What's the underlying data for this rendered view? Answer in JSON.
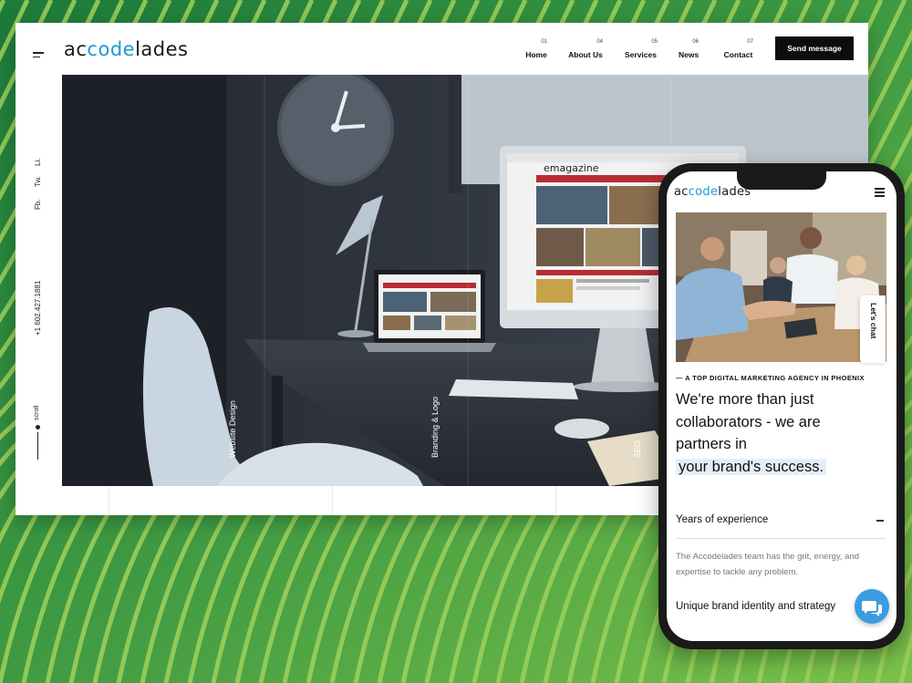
{
  "desktop": {
    "logo": {
      "prefix": "ac",
      "accent": "code",
      "suffix": "lades"
    },
    "nav": [
      {
        "num": "01",
        "label": "Home"
      },
      {
        "num": "04",
        "label": "About Us"
      },
      {
        "num": "05",
        "label": "Services"
      },
      {
        "num": "06",
        "label": "News"
      },
      {
        "num": "07",
        "label": "Contact"
      }
    ],
    "send_button": "Send message",
    "social": [
      "Li.",
      "Tw.",
      "Fb."
    ],
    "phone": "+1 602.427.1881",
    "scroll_label": "scroll",
    "hero_labels": [
      "Website Design",
      "Branding & Logo",
      "SEO"
    ],
    "screen_brand": "emagazine"
  },
  "phone": {
    "logo": {
      "prefix": "ac",
      "accent": "code",
      "suffix": "lades"
    },
    "chat_tab": "Let's chat",
    "eyebrow": "— A TOP DIGITAL MARKETING AGENCY IN PHOENIX",
    "headline_lines": [
      "We're more than just",
      "collaborators - we are",
      "partners in"
    ],
    "headline_highlight": " your brand's success.",
    "accordion": [
      {
        "title": "Years of experience",
        "body": "The Accodelades team has the grit, energy, and expertise to tackle any problem."
      },
      {
        "title": "Unique brand identity and strategy"
      }
    ]
  },
  "colors": {
    "accent": "#1a9bd7",
    "background_green": "#2f8a3e",
    "fab": "#3a9de0",
    "button": "#0d0d0d"
  },
  "icons": [
    "hamburger-icon",
    "chat-bubble-icon"
  ]
}
